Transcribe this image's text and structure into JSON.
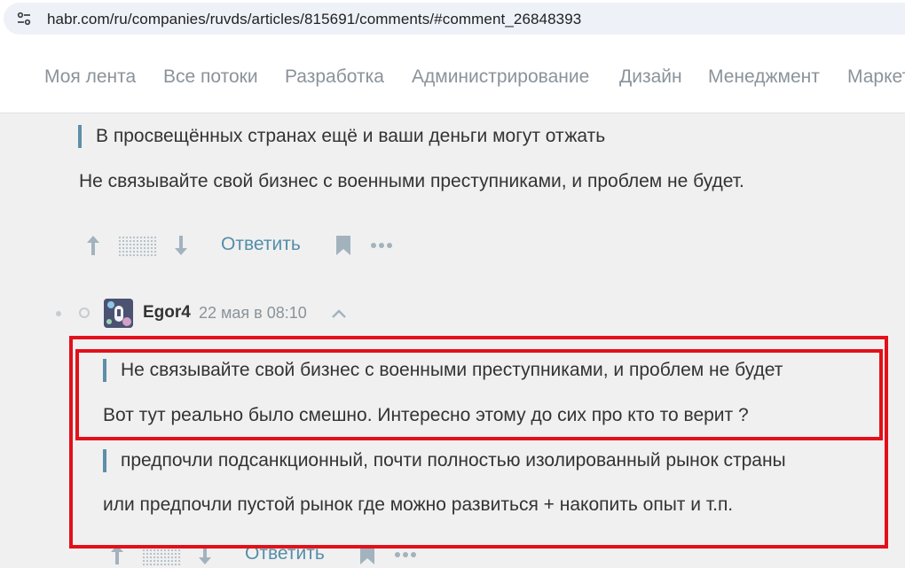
{
  "browser": {
    "url": "habr.com/ru/companies/ruvds/articles/815691/comments/#comment_26848393"
  },
  "nav": {
    "items": [
      "Моя лента",
      "Все потоки",
      "Разработка",
      "Администрирование",
      "Дизайн",
      "Менеджмент",
      "Маркетинг"
    ]
  },
  "comment_prev": {
    "quote": "В просвещённых странах ещё и ваши деньги могут отжать",
    "text": "Не связывайте свой бизнес с военными преступниками, и проблем не будет.",
    "reply_label": "Ответить"
  },
  "comment_egor": {
    "author": "Egor4",
    "time": "22 мая в 08:10",
    "quote1": "Не связывайте свой бизнес с военными преступниками, и проблем не будет",
    "text1": "Вот тут реально было смешно. Интересно этому до сих про кто то верит ?",
    "quote2": "предпочли подсанкционный, почти полностью изолированный рынок страны",
    "text2": "или предпочли пустой рынок где можно развиться + накопить опыт и т.п.",
    "reply_label": "Ответить"
  },
  "colors": {
    "highlight": "#e3101a",
    "accent": "#548eaa",
    "quote_bar": "#5e8fa8"
  },
  "icons": [
    "site-info-icon",
    "vote-up-icon",
    "vote-down-icon",
    "bookmark-icon",
    "more-icon",
    "collapse-chevron-icon"
  ]
}
